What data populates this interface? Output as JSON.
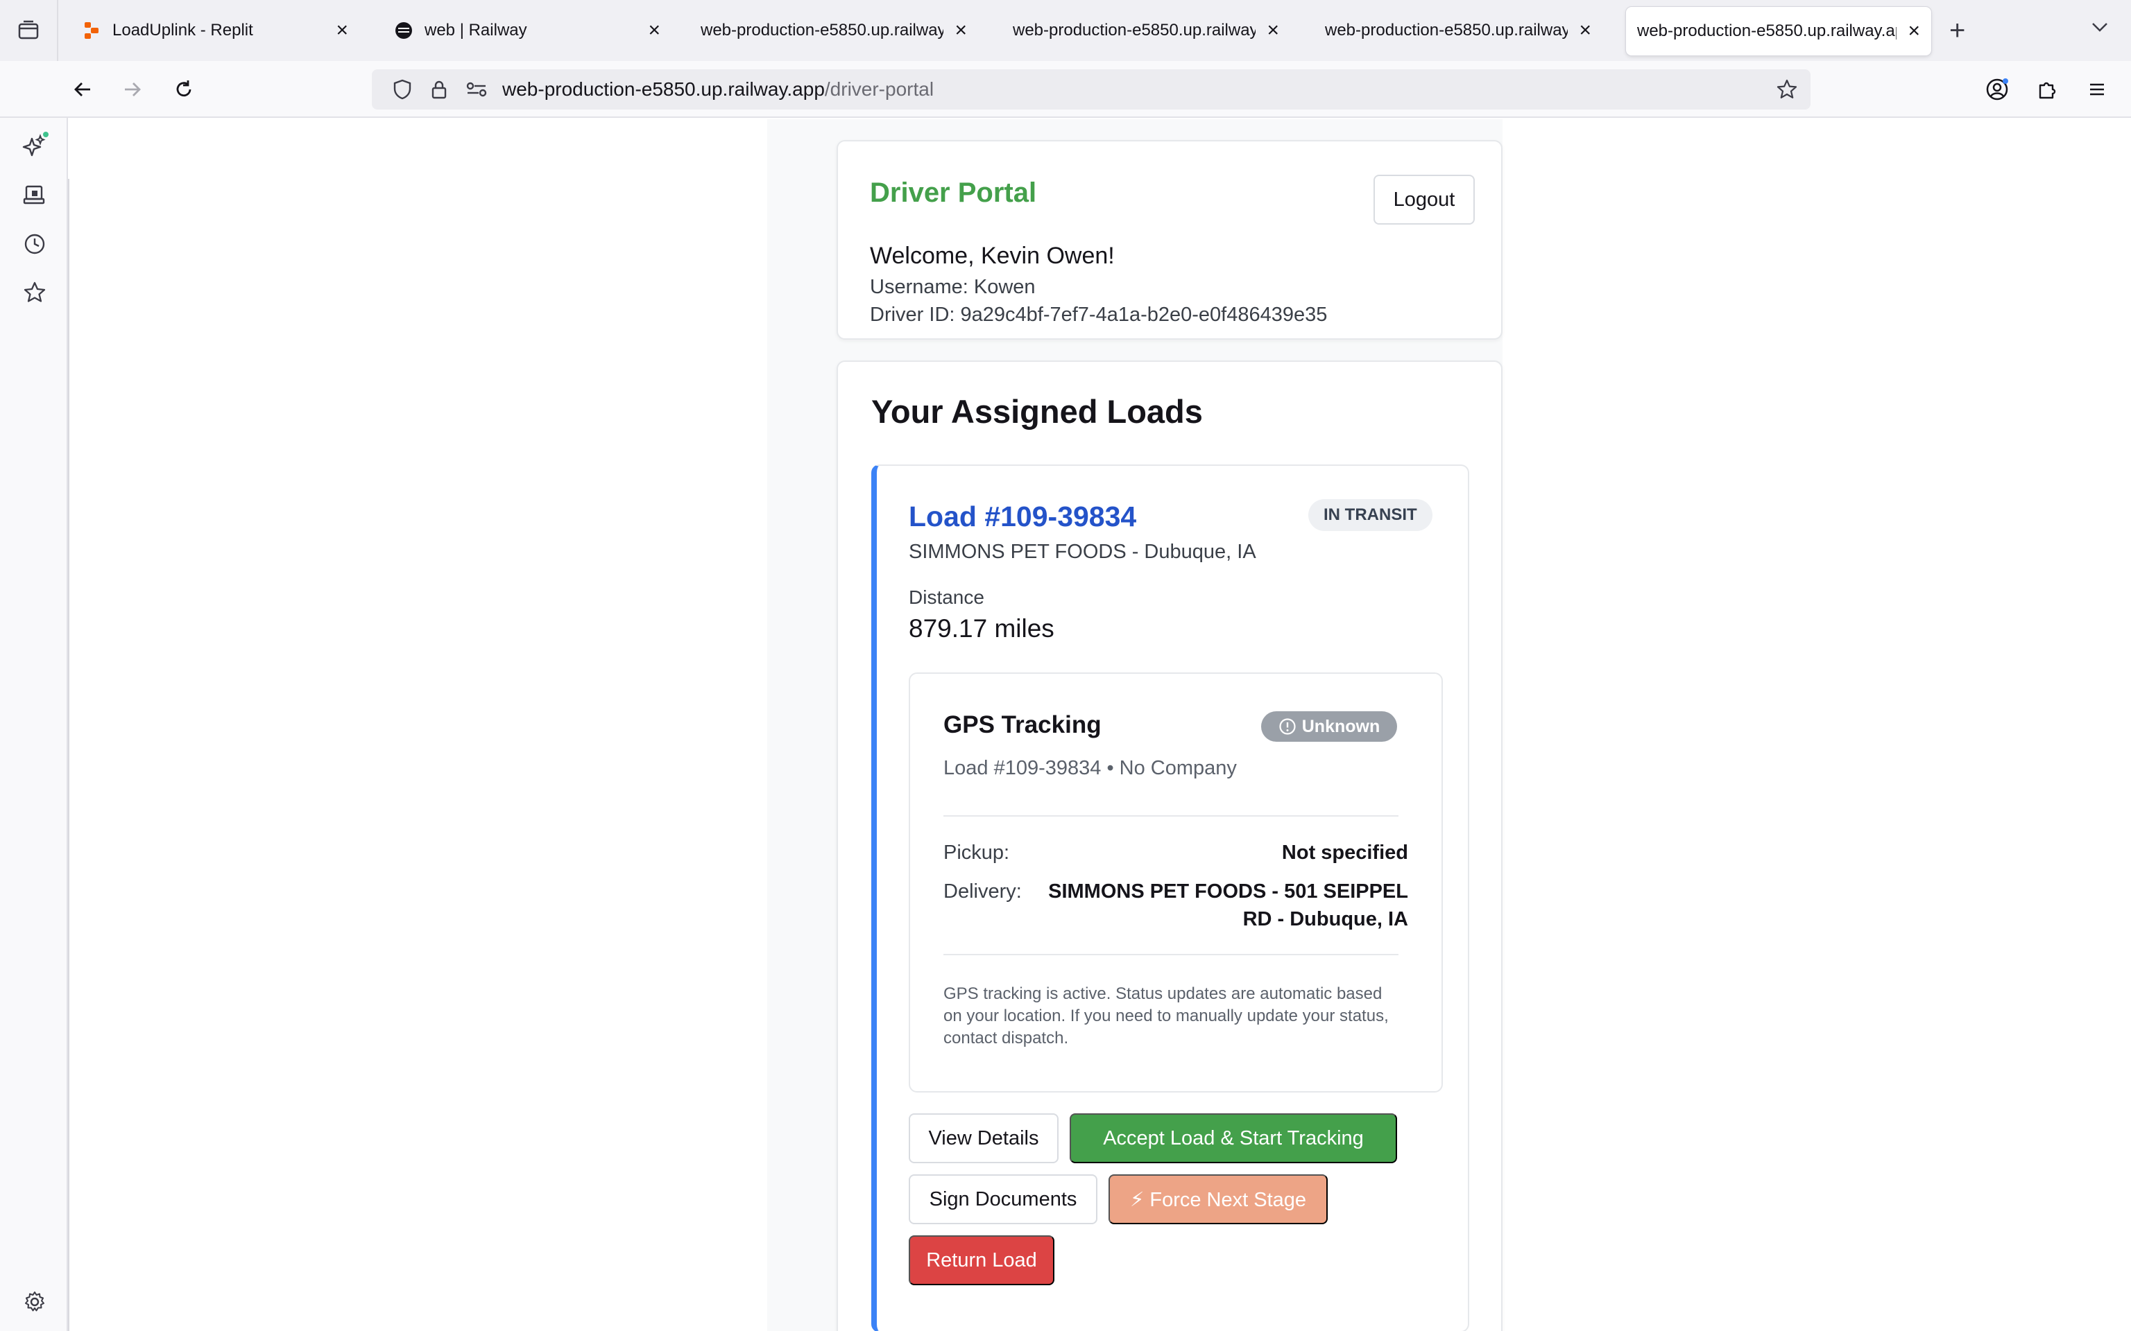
{
  "browser": {
    "tabs": [
      {
        "title": "LoadUplink - Replit",
        "favicon": "replit-icon",
        "active": false
      },
      {
        "title": "web | Railway",
        "favicon": "railway-icon",
        "active": false
      },
      {
        "title": "web-production-e5850.up.railway.app",
        "favicon": "",
        "active": false
      },
      {
        "title": "web-production-e5850.up.railway.app",
        "favicon": "",
        "active": false
      },
      {
        "title": "web-production-e5850.up.railway.app",
        "favicon": "",
        "active": false
      },
      {
        "title": "web-production-e5850.up.railway.app",
        "favicon": "",
        "active": true
      }
    ],
    "url_host": "web-production-e5850.up.railway.app",
    "url_path": "/driver-portal"
  },
  "header": {
    "title": "Driver Portal",
    "welcome": "Welcome, Kevin Owen!",
    "username": "Username: Kowen",
    "driver_id": "Driver ID: 9a29c4bf-7ef7-4a1a-b2e0-e0f486439e35",
    "logout_label": "Logout"
  },
  "loads": {
    "title": "Your Assigned Loads",
    "items": [
      {
        "number": "Load #109-39834",
        "status": "IN TRANSIT",
        "shipper": "SIMMONS PET FOODS - Dubuque, IA",
        "distance_label": "Distance",
        "distance_value": "879.17 miles",
        "gps": {
          "title": "GPS Tracking",
          "badge": "Unknown",
          "subtitle": "Load #109-39834 • No Company",
          "pickup_label": "Pickup:",
          "pickup_value": "Not specified",
          "delivery_label": "Delivery:",
          "delivery_value_line1": "SIMMONS PET FOODS - 501 SEIPPEL",
          "delivery_value_line2": "RD - Dubuque, IA",
          "note": "GPS tracking is active. Status updates are automatic based on your location. If you need to manually update your status, contact dispatch."
        },
        "actions": {
          "view_details": "View Details",
          "accept": "Accept Load & Start Tracking",
          "sign_documents": "Sign Documents",
          "force_next": "⚡ Force Next Stage",
          "return_load": "Return Load"
        }
      }
    ]
  },
  "colors": {
    "portal_title": "#44a04b",
    "load_link": "#2453c9",
    "accent_border": "#3b82f6",
    "accept_button": "#44a04b",
    "force_button": "#eda486",
    "return_button": "#dc4444",
    "status_badge_bg": "#eef0f3",
    "gps_badge_bg": "#9aa0a8"
  }
}
